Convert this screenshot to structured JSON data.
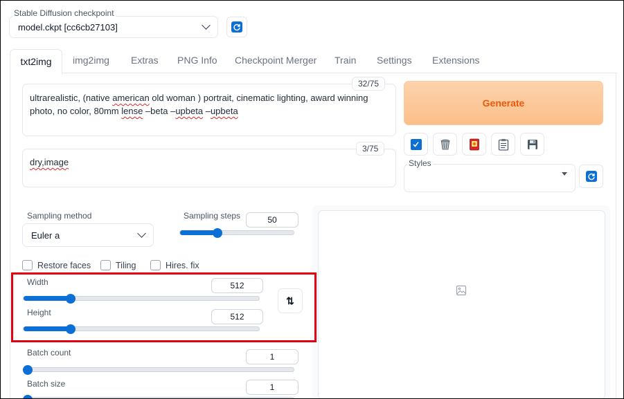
{
  "checkpoint": {
    "label": "Stable Diffusion checkpoint",
    "value": "model.ckpt [cc6cb27103]",
    "refresh_icon": "refresh-icon"
  },
  "tabs": [
    {
      "label": "txt2img",
      "active": true
    },
    {
      "label": "img2img"
    },
    {
      "label": "Extras"
    },
    {
      "label": "PNG Info"
    },
    {
      "label": "Checkpoint Merger"
    },
    {
      "label": "Train"
    },
    {
      "label": "Settings"
    },
    {
      "label": "Extensions"
    }
  ],
  "prompt": {
    "p1": "ultrarealistic, (native ",
    "w1": "american",
    "p2": " old woman ) portrait, cinematic lighting, award winning photo, no color, 80mm ",
    "w2": "lense",
    "p3": " –beta –",
    "w3": "upbeta",
    "p4": " –",
    "w4": "upbeta",
    "counter": "32/75"
  },
  "negative_prompt": {
    "w1": "dry,image",
    "counter": "3/75"
  },
  "generate_label": "Generate",
  "tool_icons": [
    "check-icon",
    "trash-icon",
    "card-icon",
    "clipboard-icon",
    "save-icon"
  ],
  "styles": {
    "label": "Styles",
    "value": ""
  },
  "sampling_method": {
    "label": "Sampling method",
    "value": "Euler a"
  },
  "sampling_steps": {
    "label": "Sampling steps",
    "value": "50",
    "fraction": 0.33
  },
  "checkboxes": {
    "restore_faces": "Restore faces",
    "tiling": "Tiling",
    "hires_fix": "Hires. fix"
  },
  "width": {
    "label": "Width",
    "value": "512",
    "fraction": 0.2
  },
  "height": {
    "label": "Height",
    "value": "512",
    "fraction": 0.2
  },
  "swap_label": "⇅",
  "batch_count": {
    "label": "Batch count",
    "value": "1",
    "fraction": 0.0
  },
  "batch_size": {
    "label": "Batch size",
    "value": "1",
    "fraction": 0.0
  },
  "accent": "#0b6fd6",
  "highlight_color": "#e3000f"
}
